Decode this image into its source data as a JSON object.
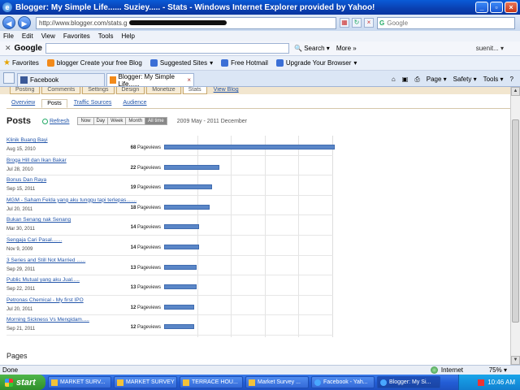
{
  "window": {
    "title": "Blogger: My Simple Life...... Suziey..... - Stats - Windows Internet Explorer provided by Yahoo!"
  },
  "address": {
    "url_prefix": "http://www.blogger.com/stats.g",
    "search_placeholder": "Google"
  },
  "menu": [
    "File",
    "Edit",
    "View",
    "Favorites",
    "Tools",
    "Help"
  ],
  "google_toolbar": {
    "logo": "Google",
    "search_label": "Search",
    "more_label": "More",
    "user": "suenit..."
  },
  "favorites": {
    "label": "Favorites",
    "items": [
      "blogger Create your free Blog",
      "Suggested Sites",
      "Free Hotmail",
      "Upgrade Your Browser"
    ]
  },
  "tabs": [
    {
      "label": "Facebook",
      "active": false
    },
    {
      "label": "Blogger: My Simple Life......",
      "active": true
    }
  ],
  "tab_tools": [
    "Page",
    "Safety",
    "Tools"
  ],
  "blogger_nav": [
    "Posting",
    "Comments",
    "Settings",
    "Design",
    "Monetize",
    "Stats"
  ],
  "blogger_view_link": "View Blog",
  "stats_tabs": [
    "Overview",
    "Posts",
    "Traffic Sources",
    "Audience"
  ],
  "posts_section": {
    "heading": "Posts",
    "refresh": "Refresh",
    "ranges": [
      "Now",
      "Day",
      "Week",
      "Month",
      "All time"
    ],
    "date_range": "2009 May - 2011 December"
  },
  "chart_data": {
    "type": "bar",
    "orientation": "horizontal",
    "unit": "Pageviews",
    "categories": [
      "Klinik Buang Bayi",
      "Broga Hill dan Ikan Bakar",
      "Bonus Dan Raya",
      "MGM - Saham Felda yang aku tunggu tapi terlepas.......",
      "Bukan Senang nak Senang",
      "Sengaja Cari Pasal.......",
      "3 Series and Still Not Married ......",
      "Public Mutual yang aku Jual.....",
      "Petronas Chemical - My first IPO",
      "Morning Sickness Vs Mengidam....."
    ],
    "dates": [
      "Aug 15, 2010",
      "Jul 28, 2010",
      "Sep 15, 2011",
      "Jul 20, 2011",
      "Mar 30, 2011",
      "Nov 9, 2009",
      "Sep 29, 2011",
      "Sep 22, 2011",
      "Jul 20, 2011",
      "Sep 21, 2011"
    ],
    "values": [
      68,
      22,
      19,
      18,
      14,
      14,
      13,
      13,
      12,
      12
    ],
    "xlim": [
      0,
      68
    ],
    "grid": true
  },
  "pages_heading": "Pages",
  "status": {
    "text": "Done",
    "zone": "Internet",
    "zoom": "75%"
  },
  "taskbar": {
    "start": "start",
    "items": [
      "MARKET SURV...",
      "MARKET SURVEY",
      "TERRACE HOU...",
      "Market Survey ...",
      "Facebook - Yah...",
      "Blogger: My Si..."
    ],
    "clock": "10:46 AM"
  }
}
